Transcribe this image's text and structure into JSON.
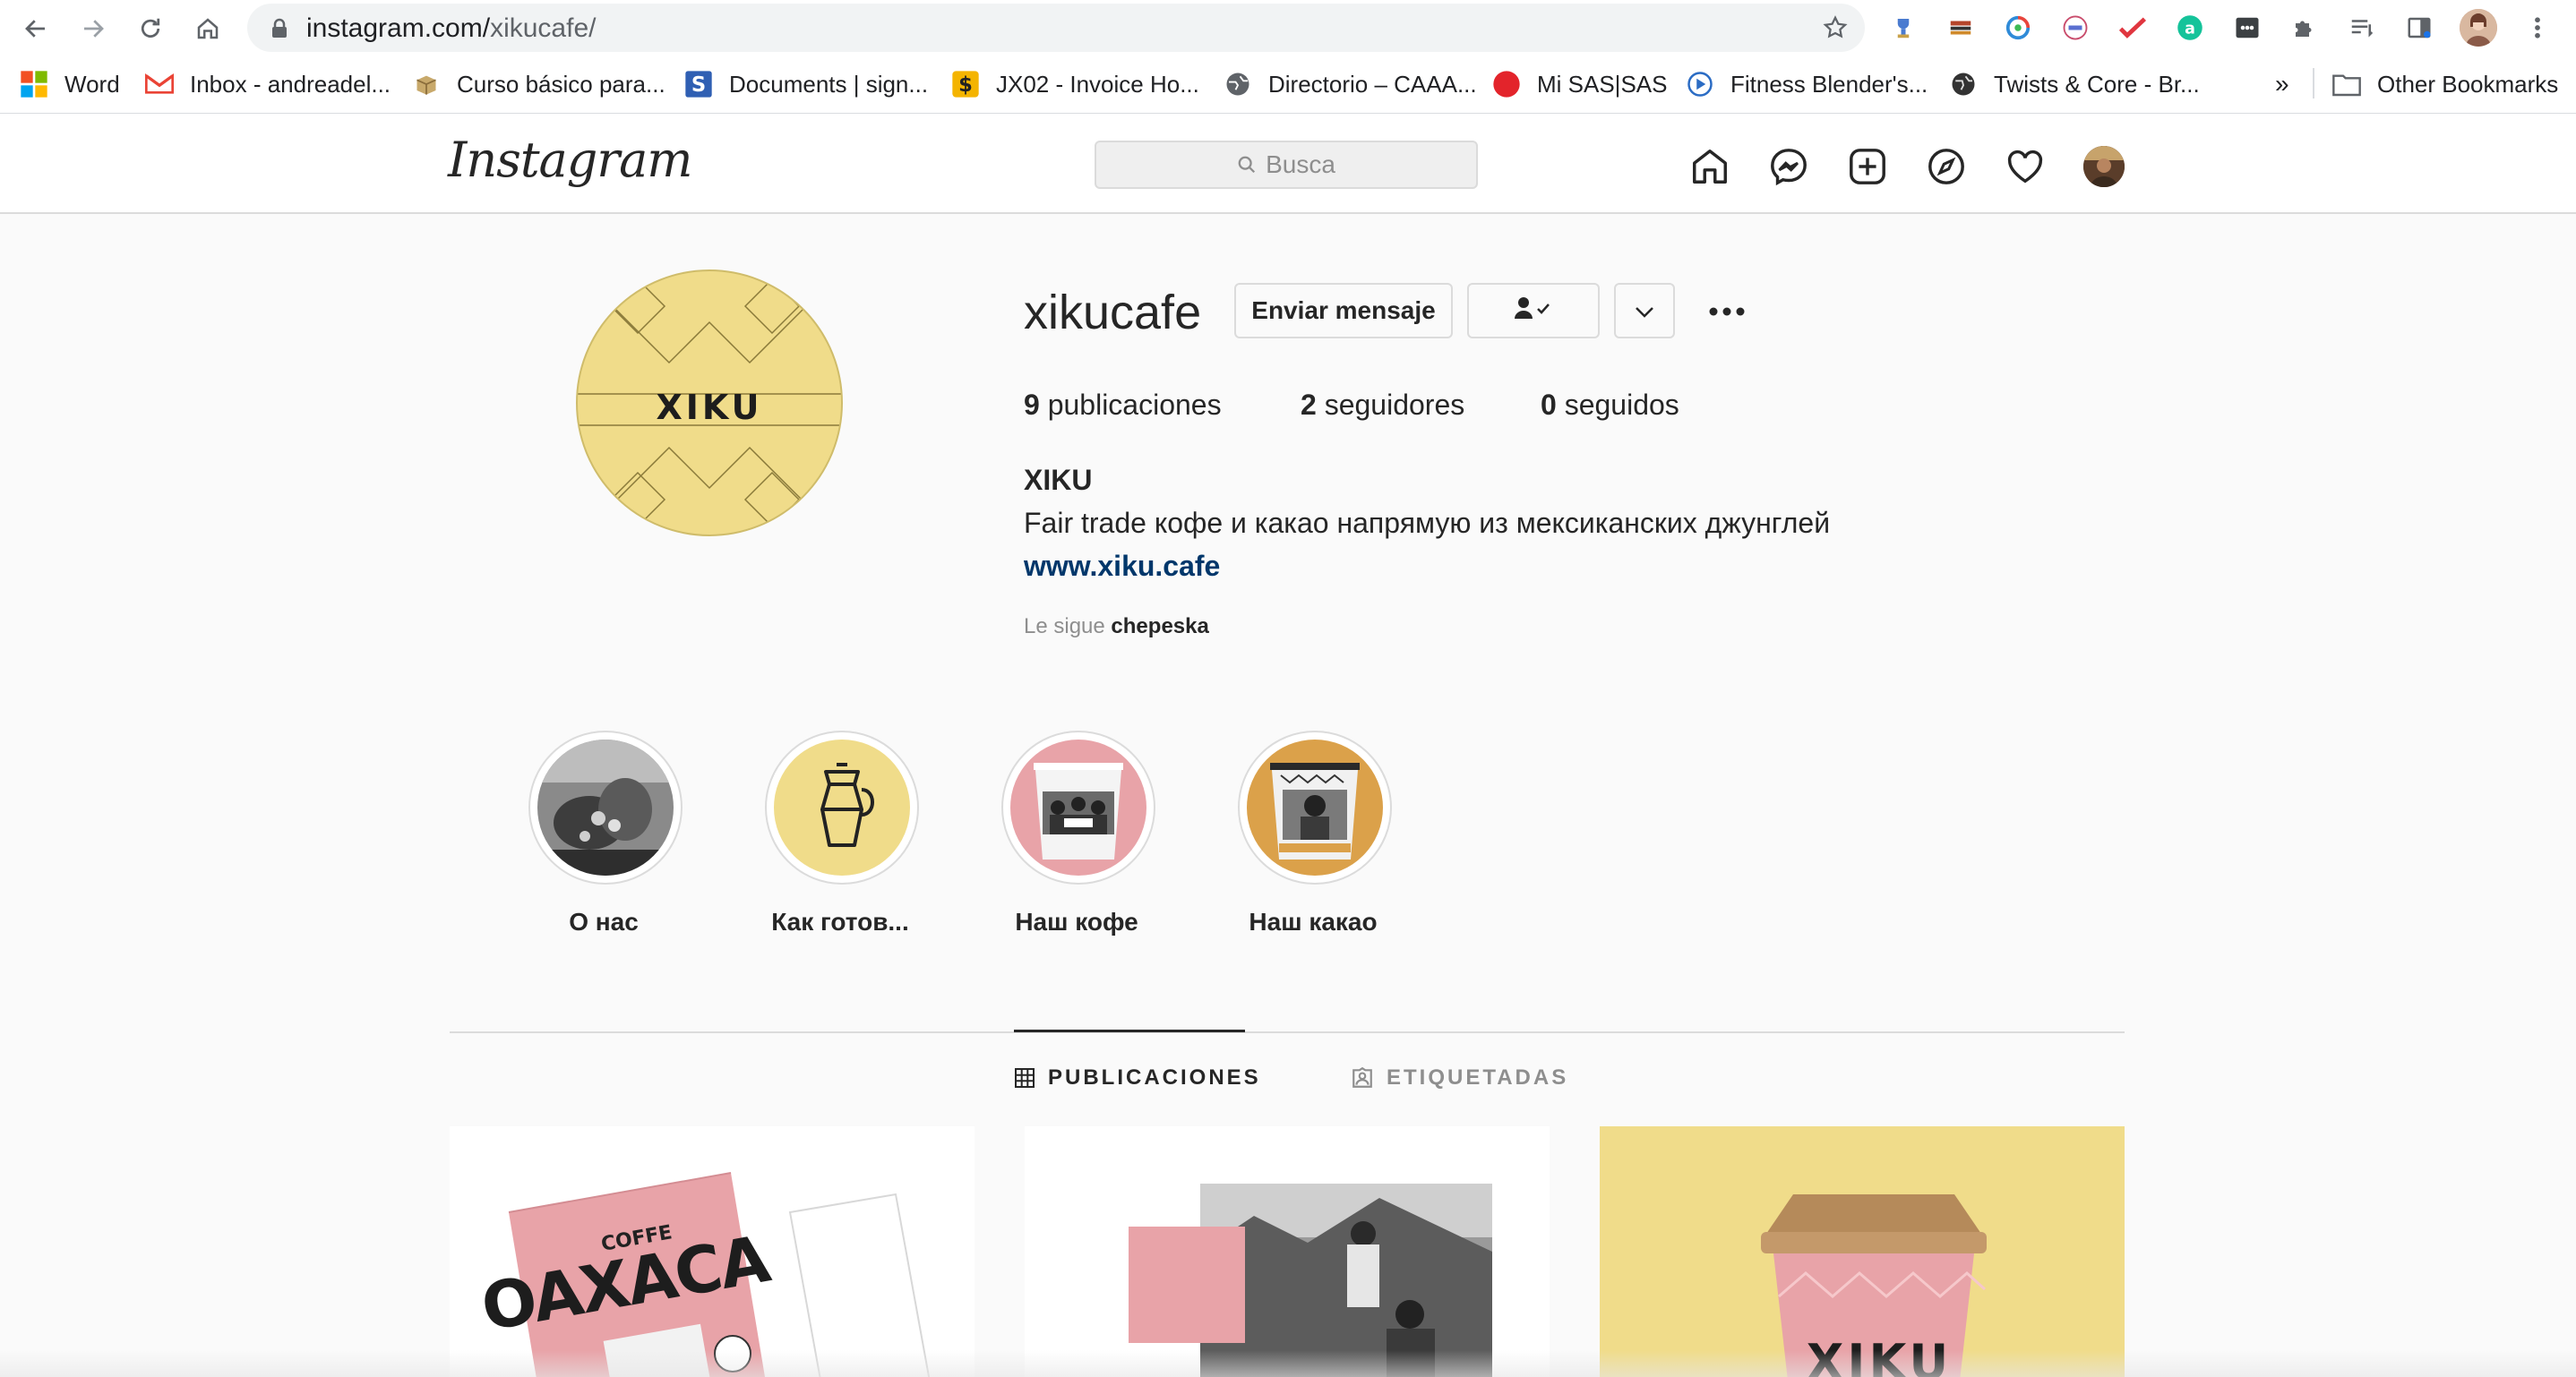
{
  "browser": {
    "url_host": "instagram.com/",
    "url_path": "xikucafe/",
    "bookmarks": [
      {
        "label": "Word",
        "icon": "microsoft-icon"
      },
      {
        "label": "Inbox - andreadel...",
        "icon": "gmail-icon"
      },
      {
        "label": "Curso básico para...",
        "icon": "box-icon"
      },
      {
        "label": "Documents | sign...",
        "icon": "signnow-icon"
      },
      {
        "label": "JX02 - Invoice Ho...",
        "icon": "dollar-icon"
      },
      {
        "label": "Directorio – CAAA...",
        "icon": "globe-icon"
      },
      {
        "label": "Mi SAS|SAS",
        "icon": "red-dot-icon"
      },
      {
        "label": "Fitness Blender's...",
        "icon": "fitness-icon"
      },
      {
        "label": "Twists & Core - Br...",
        "icon": "globe-dark-icon"
      }
    ],
    "overflow": "»",
    "other_bookmarks": "Other Bookmarks"
  },
  "instagram": {
    "logo": "Instagram",
    "search_placeholder": "Busca"
  },
  "profile": {
    "username": "xikucafe",
    "message_button": "Enviar mensaje",
    "posts_count": "9",
    "posts_label": "publicaciones",
    "followers_count": "2",
    "followers_label": "seguidores",
    "following_count": "0",
    "following_label": "seguidos",
    "full_name": "XIKU",
    "bio": "Fair trade кофе и какао напрямую из мексиканских джунглей",
    "website": "www.xiku.cafe",
    "followed_by_prefix": "Le sigue",
    "followed_by_user": "chepeska",
    "avatar_text": "XIKU"
  },
  "highlights": [
    {
      "label": "О нас"
    },
    {
      "label": "Как готов..."
    },
    {
      "label": "Наш кофе"
    },
    {
      "label": "Наш какао"
    }
  ],
  "tabs": {
    "posts": "PUBLICACIONES",
    "tagged": "ETIQUETADAS"
  },
  "posts": [
    {
      "text_top": "COFFE",
      "text_main": "OAXACA"
    },
    {},
    {
      "text_main": "XIKU"
    }
  ],
  "colors": {
    "brand_yellow": "#f0dc8a",
    "brand_pink": "#e8a3a8",
    "link_blue": "#00376b"
  }
}
